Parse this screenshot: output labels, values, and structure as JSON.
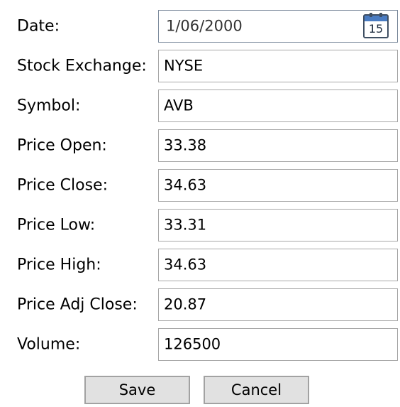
{
  "form": {
    "date": {
      "label": "Date:",
      "value": "1/06/2000",
      "icon": "calendar-icon",
      "icon_day": "15"
    },
    "stock_exchange": {
      "label": "Stock Exchange:",
      "value": "NYSE"
    },
    "symbol": {
      "label": "Symbol:",
      "value": "AVB"
    },
    "price_open": {
      "label": "Price Open:",
      "value": "33.38"
    },
    "price_close": {
      "label": "Price Close:",
      "value": "34.63"
    },
    "price_low": {
      "label": "Price Low:",
      "value": "33.31"
    },
    "price_high": {
      "label": "Price High:",
      "value": "34.63"
    },
    "price_adj_close": {
      "label": "Price Adj Close:",
      "value": "20.87"
    },
    "volume": {
      "label": "Volume:",
      "value": "126500"
    }
  },
  "actions": {
    "save_label": "Save",
    "cancel_label": "Cancel"
  },
  "colors": {
    "field_border": "#a7a7a7",
    "date_border": "#7d8b9d",
    "button_bg": "#e1e1e1",
    "button_border": "#a2a2a2",
    "calendar_accent": "#4a7cc2"
  }
}
